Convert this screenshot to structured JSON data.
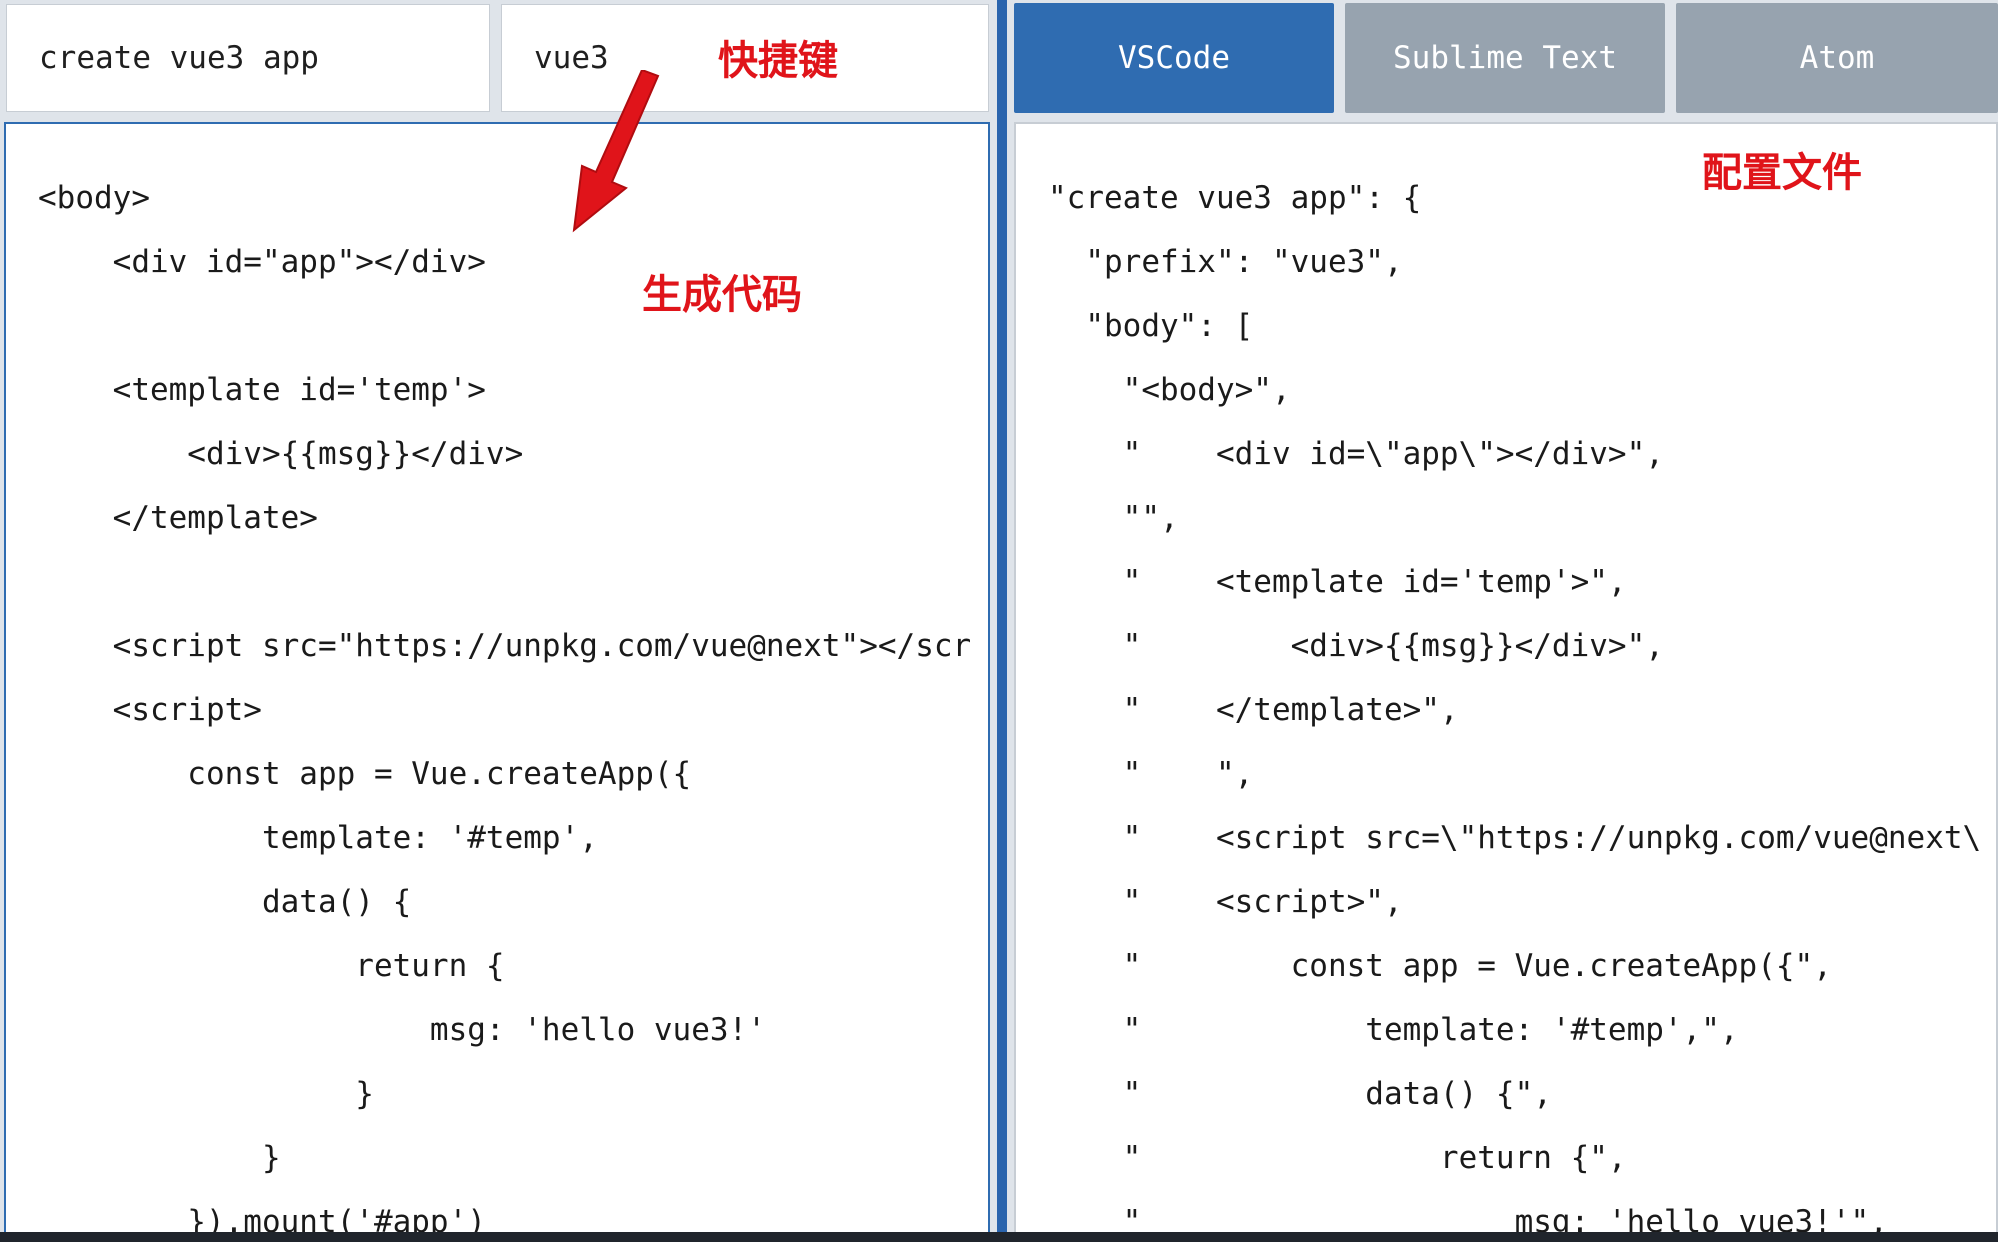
{
  "snippet_form": {
    "description_value": "create vue3 app",
    "prefix_value": "vue3"
  },
  "editor_tabs": [
    {
      "label": "VSCode",
      "active": true
    },
    {
      "label": "Sublime Text",
      "active": false
    },
    {
      "label": "Atom",
      "active": false
    }
  ],
  "annotations": {
    "shortcut": "快捷键",
    "generated_code": "生成代码",
    "config_file": "配置文件"
  },
  "generated_code_lines": [
    "<body>",
    "    <div id=\"app\"></div>",
    "",
    "    <template id='temp'>",
    "        <div>{{msg}}</div>",
    "    </template>",
    "",
    "    <script src=\"https://unpkg.com/vue@next\"></scr",
    "    <script>",
    "        const app = Vue.createApp({",
    "            template: '#temp',",
    "            data() {",
    "                 return {",
    "                     msg: 'hello vue3!'",
    "                 }",
    "            }",
    "        }).mount('#app')"
  ],
  "config_code_lines": [
    "\"create vue3 app\": {",
    "  \"prefix\": \"vue3\",",
    "  \"body\": [",
    "    \"<body>\",",
    "    \"    <div id=\\\"app\\\"></div>\",",
    "    \"\",",
    "    \"    <template id='temp'>\",",
    "    \"        <div>{{msg}}</div>\",",
    "    \"    </template>\",",
    "    \"    \",",
    "    \"    <script src=\\\"https://unpkg.com/vue@next\\",
    "    \"    <script>\",",
    "    \"        const app = Vue.createApp({\",",
    "    \"            template: '#temp',\",",
    "    \"            data() {\",",
    "    \"                return {\",",
    "    \"                    msg: 'hello vue3!'\","
  ],
  "colors": {
    "accent": "#2f6cb1",
    "inactive_tab": "#97a3af",
    "annotation": "#e0141a"
  }
}
